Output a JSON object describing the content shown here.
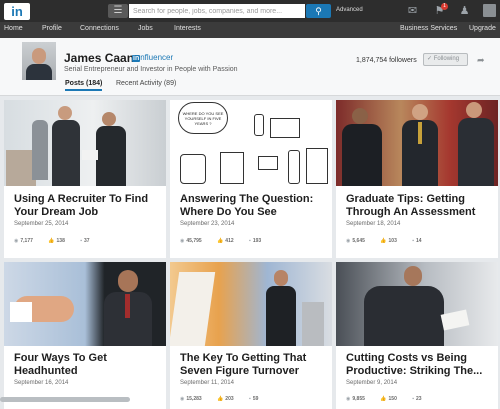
{
  "topbar": {
    "logo": "in",
    "search_placeholder": "Search for people, jobs, companies, and more...",
    "search_icon": "search-icon",
    "advanced": "Advanced",
    "notification_count": "1"
  },
  "nav": {
    "items": [
      "Home",
      "Profile",
      "Connections",
      "Jobs",
      "Interests"
    ],
    "right": [
      "Business Services",
      "Upgrade"
    ]
  },
  "profile": {
    "name": "James Caan",
    "influencer": "nfluencer",
    "headline": "Serial Entrepreneur and Investor in People with Passion",
    "followers": "1,874,754 followers",
    "follow_button": "Following",
    "tabs": [
      "Posts (184)",
      "Recent Activity (89)"
    ]
  },
  "posts": [
    {
      "title": "Using A Recruiter To Find Your Dream Job",
      "date": "September 25, 2014",
      "views": "7,177",
      "likes": "138",
      "comments": "37"
    },
    {
      "title": "Answering The Question: Where Do You See",
      "date": "September 23, 2014",
      "views": "45,795",
      "likes": "412",
      "comments": "193"
    },
    {
      "title": "Graduate Tips: Getting Through An Assessment",
      "date": "September 18, 2014",
      "views": "5,645",
      "likes": "103",
      "comments": "14"
    },
    {
      "title": "Four Ways To Get Headhunted",
      "date": "September 16, 2014",
      "views": "",
      "likes": "",
      "comments": ""
    },
    {
      "title": "The Key To Getting That Seven Figure Turnover",
      "date": "September 11, 2014",
      "views": "15,283",
      "likes": "203",
      "comments": "59"
    },
    {
      "title": "Cutting Costs vs Being Productive: Striking The...",
      "date": "September 9, 2014",
      "views": "9,855",
      "likes": "150",
      "comments": "23"
    }
  ],
  "cartoon_text": "WHERE DO YOU SEE YOURSELF IN FIVE YEARS ?",
  "colors": {
    "brand": "#1b78b5",
    "topbar": "#2d2d2d",
    "nav": "#3b3b3b"
  }
}
